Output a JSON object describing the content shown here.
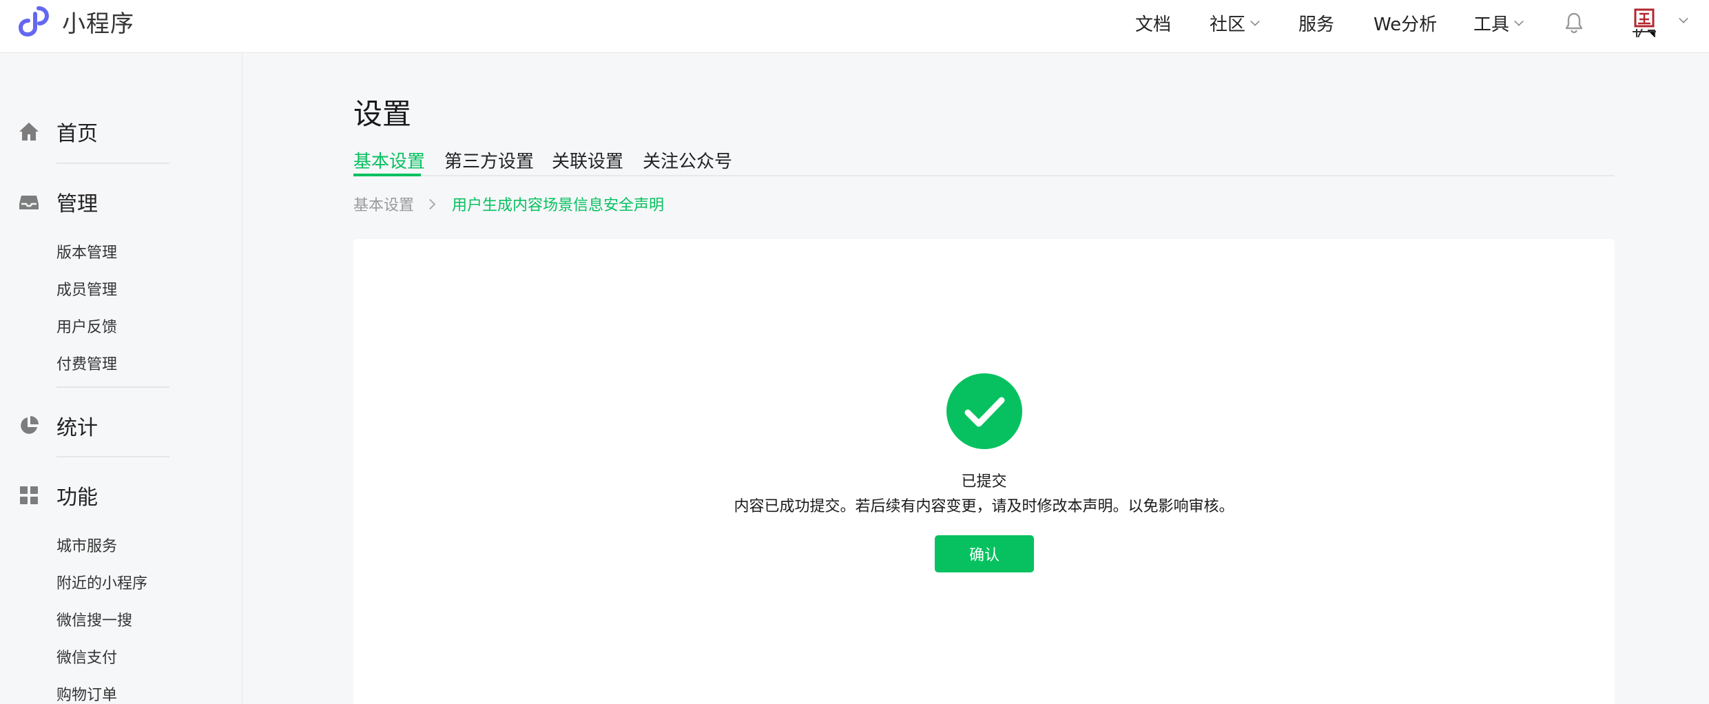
{
  "brand": {
    "name": "小程序",
    "color": "#6467f0"
  },
  "topnav": {
    "docs": "文档",
    "community": "社区",
    "service": "服务",
    "analysis": "We分析",
    "tools": "工具"
  },
  "sidebar": {
    "home": "首页",
    "manage": "管理",
    "manage_items": [
      "版本管理",
      "成员管理",
      "用户反馈",
      "付费管理"
    ],
    "stats": "统计",
    "features": "功能",
    "feature_items": [
      "城市服务",
      "附近的小程序",
      "微信搜一搜",
      "微信支付",
      "购物订单"
    ]
  },
  "page": {
    "title": "设置",
    "tabs": [
      "基本设置",
      "第三方设置",
      "关联设置",
      "关注公众号"
    ],
    "active_tab": 0,
    "breadcrumb": [
      "基本设置",
      "用户生成内容场景信息安全声明"
    ]
  },
  "result": {
    "title": "已提交",
    "description": "内容已成功提交。若后续有内容变更，请及时修改本声明。以免影响审核。",
    "confirm_label": "确认"
  },
  "colors": {
    "accent": "#07c160",
    "background": "#f6f7f9"
  },
  "icons": {
    "home": "home-icon",
    "manage": "inbox-icon",
    "stats": "pie-chart-icon",
    "features": "grid-icon",
    "bell": "bell-icon",
    "success": "check-circle-icon"
  }
}
